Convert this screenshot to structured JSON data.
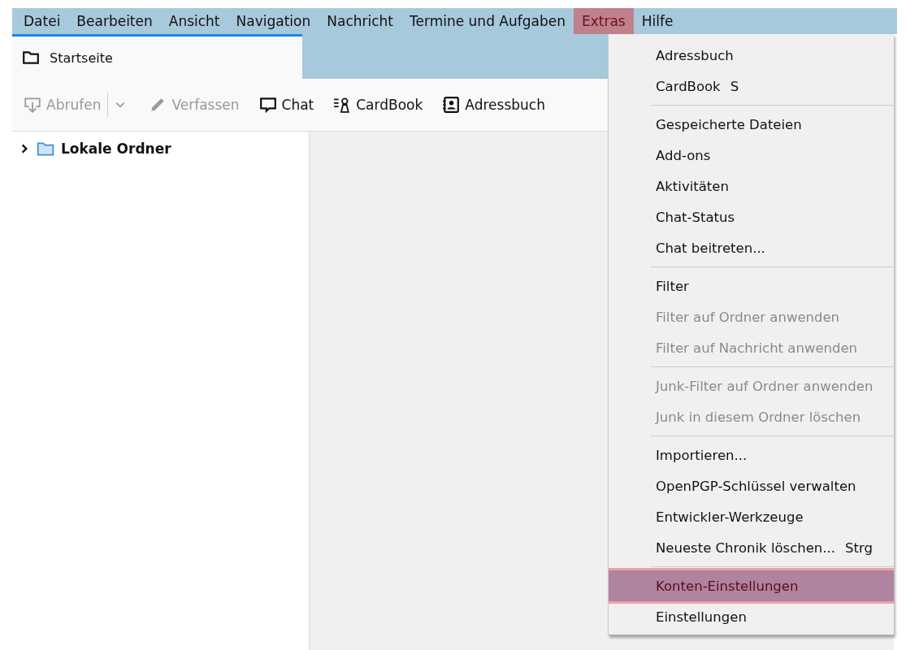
{
  "menubar": [
    {
      "label": "Datei",
      "selected": false
    },
    {
      "label": "Bearbeiten",
      "selected": false
    },
    {
      "label": "Ansicht",
      "selected": false
    },
    {
      "label": "Navigation",
      "selected": false
    },
    {
      "label": "Nachricht",
      "selected": false
    },
    {
      "label": "Termine und Aufgaben",
      "selected": false
    },
    {
      "label": "Extras",
      "selected": true
    },
    {
      "label": "Hilfe",
      "selected": false
    }
  ],
  "tab": {
    "label": "Startseite"
  },
  "toolbar": [
    {
      "label": "Abrufen",
      "kind": "download",
      "disabled": true,
      "dropdown": true
    },
    {
      "label": "Verfassen",
      "kind": "pencil",
      "disabled": true,
      "dropdown": false
    },
    {
      "label": "Chat",
      "kind": "chat",
      "disabled": false,
      "dropdown": false
    },
    {
      "label": "CardBook",
      "kind": "cardbook",
      "disabled": false,
      "dropdown": false
    },
    {
      "label": "Adressbuch",
      "kind": "addressbook",
      "disabled": false,
      "dropdown": false
    }
  ],
  "folders": [
    {
      "label": "Lokale Ordner",
      "expanded": false
    }
  ],
  "menu": [
    {
      "kind": "item",
      "label": "Adressbuch",
      "disabled": false,
      "selected": false
    },
    {
      "kind": "item",
      "label": "CardBook",
      "shortcut": "S",
      "disabled": false,
      "selected": false
    },
    {
      "kind": "separator"
    },
    {
      "kind": "item",
      "label": "Gespeicherte Dateien",
      "disabled": false,
      "selected": false
    },
    {
      "kind": "item",
      "label": "Add-ons",
      "disabled": false,
      "selected": false
    },
    {
      "kind": "item",
      "label": "Aktivitäten",
      "disabled": false,
      "selected": false
    },
    {
      "kind": "item",
      "label": "Chat-Status",
      "disabled": false,
      "selected": false
    },
    {
      "kind": "item",
      "label": "Chat beitreten...",
      "disabled": false,
      "selected": false
    },
    {
      "kind": "separator"
    },
    {
      "kind": "item",
      "label": "Filter",
      "disabled": false,
      "selected": false
    },
    {
      "kind": "item",
      "label": "Filter auf Ordner anwenden",
      "disabled": true,
      "selected": false
    },
    {
      "kind": "item",
      "label": "Filter auf Nachricht anwenden",
      "disabled": true,
      "selected": false
    },
    {
      "kind": "separator"
    },
    {
      "kind": "item",
      "label": "Junk-Filter auf Ordner anwenden",
      "disabled": true,
      "selected": false
    },
    {
      "kind": "item",
      "label": "Junk in diesem Ordner löschen",
      "disabled": true,
      "selected": false
    },
    {
      "kind": "separator"
    },
    {
      "kind": "item",
      "label": "Importieren...",
      "disabled": false,
      "selected": false
    },
    {
      "kind": "item",
      "label": "OpenPGP-Schlüssel verwalten",
      "disabled": false,
      "selected": false
    },
    {
      "kind": "item",
      "label": "Entwickler-Werkzeuge",
      "disabled": false,
      "selected": false
    },
    {
      "kind": "item",
      "label": "Neueste Chronik löschen...",
      "shortcut": "Strg",
      "disabled": false,
      "selected": false
    },
    {
      "kind": "separator"
    },
    {
      "kind": "item",
      "label": "Konten-Einstellungen",
      "disabled": false,
      "selected": true
    },
    {
      "kind": "item",
      "label": "Einstellungen",
      "disabled": false,
      "selected": false
    }
  ]
}
